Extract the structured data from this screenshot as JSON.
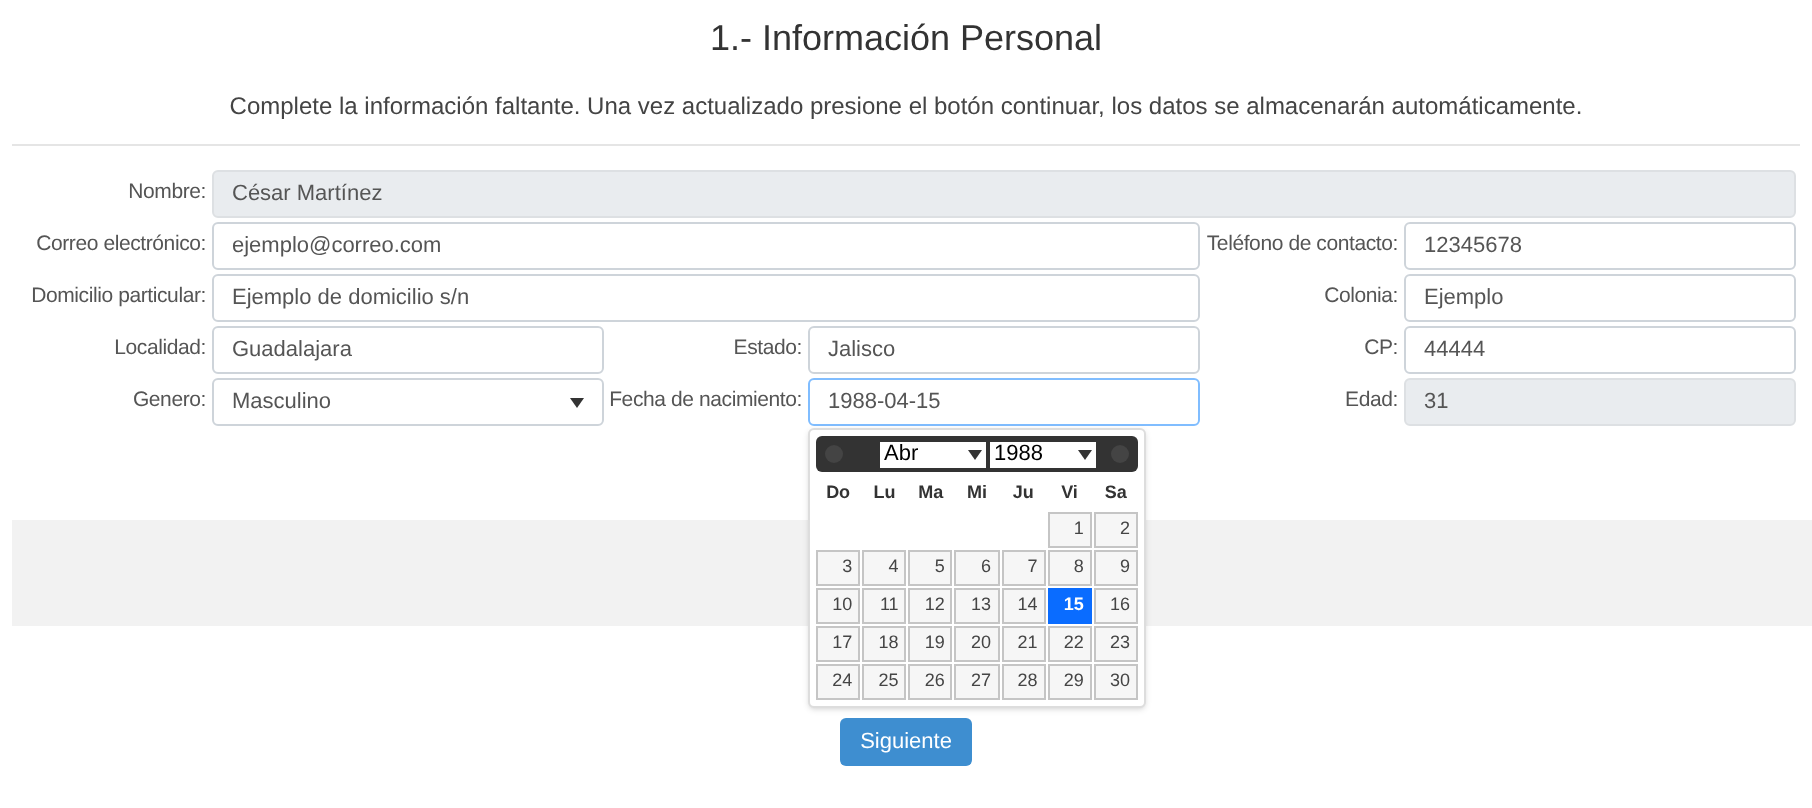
{
  "title": "1.- Información Personal",
  "instructions": "Complete la información faltante. Una vez actualizado presione el botón continuar, los datos se almacenarán automáticamente.",
  "rows": [
    [
      {
        "label": "Nombre:",
        "value": "César Martínez",
        "kind": "input",
        "disabled": true
      }
    ],
    [
      {
        "label": "Correo electrónico:",
        "value": "ejemplo@correo.com",
        "kind": "input",
        "disabled": false
      },
      {
        "label": "Teléfono de contacto:",
        "value": "12345678",
        "kind": "input",
        "disabled": false
      }
    ],
    [
      {
        "label": "Domicilio particular:",
        "value": "Ejemplo de domicilio s/n",
        "kind": "input",
        "disabled": false
      },
      {
        "label": "Colonia:",
        "value": "Ejemplo",
        "kind": "input",
        "disabled": false
      }
    ],
    [
      {
        "label": "Localidad:",
        "value": "Guadalajara",
        "kind": "input",
        "disabled": false
      },
      {
        "label": "Estado:",
        "value": "Jalisco",
        "kind": "input",
        "disabled": false
      },
      {
        "label": "CP:",
        "value": "44444",
        "kind": "input",
        "disabled": false
      }
    ],
    [
      {
        "label": "Genero:",
        "value": "Masculino",
        "kind": "select",
        "disabled": false
      },
      {
        "label": "Fecha de nacimiento:",
        "value": "1988-04-15",
        "kind": "date",
        "disabled": false,
        "focused": true
      },
      {
        "label": "Edad:",
        "value": "31",
        "kind": "input",
        "disabled": true
      }
    ]
  ],
  "calendar": {
    "month": "Abr",
    "year": "1988",
    "weekdays": [
      "Do",
      "Lu",
      "Ma",
      "Mi",
      "Ju",
      "Vi",
      "Sa"
    ],
    "weeks": [
      {
        "kind": "first",
        "days": [
          {
            "label": "1",
            "selected": false
          },
          {
            "label": "2",
            "selected": false
          }
        ]
      },
      {
        "kind": "full",
        "days": [
          {
            "label": "3",
            "selected": false
          },
          {
            "label": "4",
            "selected": false
          },
          {
            "label": "5",
            "selected": false
          },
          {
            "label": "6",
            "selected": false
          },
          {
            "label": "7",
            "selected": false
          },
          {
            "label": "8",
            "selected": false
          },
          {
            "label": "9",
            "selected": false
          }
        ]
      },
      {
        "kind": "full",
        "days": [
          {
            "label": "10",
            "selected": false
          },
          {
            "label": "11",
            "selected": false
          },
          {
            "label": "12",
            "selected": false
          },
          {
            "label": "13",
            "selected": false
          },
          {
            "label": "14",
            "selected": false
          },
          {
            "label": "15",
            "selected": true
          },
          {
            "label": "16",
            "selected": false
          }
        ]
      },
      {
        "kind": "full",
        "days": [
          {
            "label": "17",
            "selected": false
          },
          {
            "label": "18",
            "selected": false
          },
          {
            "label": "19",
            "selected": false
          },
          {
            "label": "20",
            "selected": false
          },
          {
            "label": "21",
            "selected": false
          },
          {
            "label": "22",
            "selected": false
          },
          {
            "label": "23",
            "selected": false
          }
        ]
      },
      {
        "kind": "full",
        "days": [
          {
            "label": "24",
            "selected": false
          },
          {
            "label": "25",
            "selected": false
          },
          {
            "label": "26",
            "selected": false
          },
          {
            "label": "27",
            "selected": false
          },
          {
            "label": "28",
            "selected": false
          },
          {
            "label": "29",
            "selected": false
          },
          {
            "label": "30",
            "selected": false
          }
        ]
      }
    ]
  },
  "button": "Siguiente"
}
